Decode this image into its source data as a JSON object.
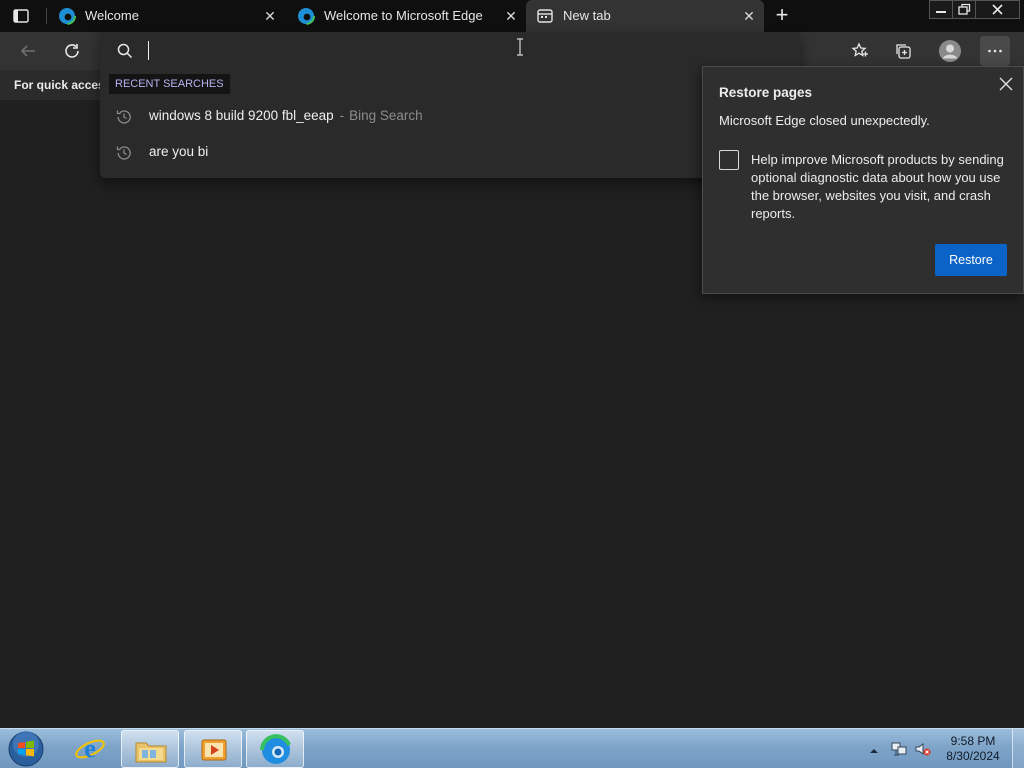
{
  "tabs": [
    {
      "title": "Welcome",
      "favicon": "edge-icon",
      "active": false
    },
    {
      "title": "Welcome to Microsoft Edge",
      "favicon": "edge-icon",
      "active": false
    },
    {
      "title": "New tab",
      "favicon": "newtab-page-icon",
      "active": true
    }
  ],
  "window_controls": {
    "minimize": "minimize-icon",
    "restore": "restore-icon",
    "close": "close-icon"
  },
  "address_bar": {
    "value": "",
    "placeholder": ""
  },
  "favorites_bar": {
    "text": "For quick access"
  },
  "omnibox": {
    "section_label": "RECENT SEARCHES",
    "suggestions": [
      {
        "text": "windows 8 build 9200 fbl_eeap",
        "separator": "-",
        "source": "Bing Search"
      },
      {
        "text": "are you bi",
        "separator": "",
        "source": ""
      }
    ]
  },
  "restore_popup": {
    "title": "Restore pages",
    "message": "Microsoft Edge closed unexpectedly.",
    "checkbox_checked": false,
    "checkbox_label": "Help improve Microsoft products by sending optional diagnostic data about how you use the browser, websites you visit, and crash reports.",
    "button_label": "Restore"
  },
  "taskbar": {
    "apps": [
      "internet-explorer-icon",
      "file-explorer-icon",
      "media-player-icon",
      "edge-icon"
    ],
    "clock_time": "9:58 PM",
    "clock_date": "8/30/2024"
  },
  "colors": {
    "accent": "#0b63c7",
    "page_background": "#202020",
    "tabstrip": "#0f0f0f",
    "toolbar": "#333333",
    "recent_label": "#b7b3f2"
  }
}
